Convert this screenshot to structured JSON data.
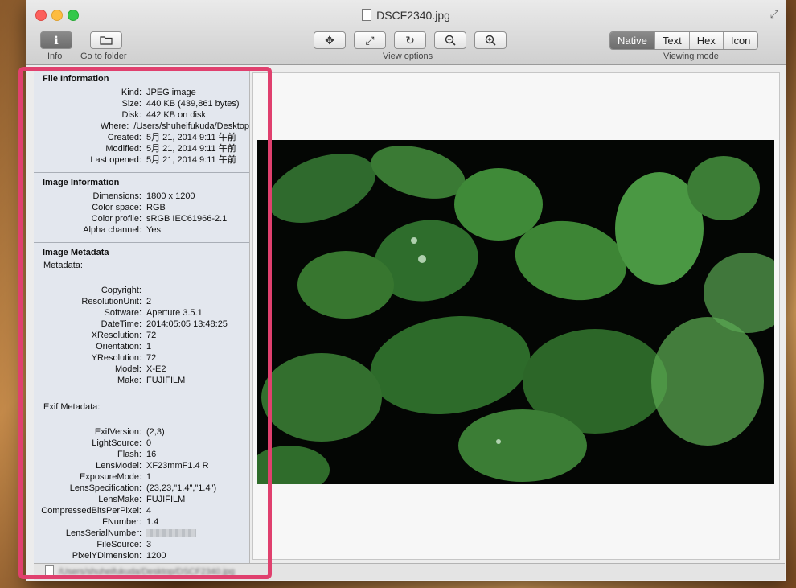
{
  "window": {
    "title": "DSCF2340.jpg"
  },
  "toolbar": {
    "info_label": "Info",
    "goto_folder_label": "Go to folder",
    "view_options_label": "View options",
    "viewing_mode_label": "Viewing mode",
    "modes": [
      "Native",
      "Text",
      "Hex",
      "Icon"
    ],
    "selected_mode": "Native"
  },
  "file_info": {
    "heading": "File Information",
    "rows": [
      {
        "k": "Kind:",
        "v": "JPEG image"
      },
      {
        "k": "Size:",
        "v": "440 KB (439,861 bytes)"
      },
      {
        "k": "Disk:",
        "v": "442 KB on disk"
      },
      {
        "k": "Where:",
        "v": "/Users/shuheifukuda/Desktop"
      },
      {
        "k": "Created:",
        "v": "5月 21, 2014 9:11 午前"
      },
      {
        "k": "Modified:",
        "v": "5月 21, 2014 9:11 午前"
      },
      {
        "k": "Last opened:",
        "v": "5月 21, 2014 9:11 午前"
      }
    ]
  },
  "image_info": {
    "heading": "Image Information",
    "rows": [
      {
        "k": "Dimensions:",
        "v": "1800 x 1200"
      },
      {
        "k": "Color space:",
        "v": "RGB"
      },
      {
        "k": "Color profile:",
        "v": "sRGB IEC61966-2.1"
      },
      {
        "k": "Alpha channel:",
        "v": "Yes"
      }
    ]
  },
  "metadata": {
    "heading": "Image Metadata",
    "sub_label": "Metadata:",
    "rows": [
      {
        "k": "Copyright:",
        "v": ""
      },
      {
        "k": "ResolutionUnit:",
        "v": "2"
      },
      {
        "k": "Software:",
        "v": "Aperture 3.5.1"
      },
      {
        "k": "DateTime:",
        "v": "2014:05:05 13:48:25"
      },
      {
        "k": "XResolution:",
        "v": "72"
      },
      {
        "k": "Orientation:",
        "v": "1"
      },
      {
        "k": "YResolution:",
        "v": "72"
      },
      {
        "k": "Model:",
        "v": "X-E2"
      },
      {
        "k": "Make:",
        "v": "FUJIFILM"
      }
    ],
    "exif_label": "Exif Metadata:",
    "exif_rows": [
      {
        "k": "ExifVersion:",
        "v": "(2,3)"
      },
      {
        "k": "LightSource:",
        "v": "0"
      },
      {
        "k": "Flash:",
        "v": "16"
      },
      {
        "k": "LensModel:",
        "v": "XF23mmF1.4 R"
      },
      {
        "k": "ExposureMode:",
        "v": "1"
      },
      {
        "k": "LensSpecification:",
        "v": "(23,23,\"1.4\",\"1.4\")"
      },
      {
        "k": "LensMake:",
        "v": "FUJIFILM"
      },
      {
        "k": "CompressedBitsPerPixel:",
        "v": "4"
      },
      {
        "k": "FNumber:",
        "v": "1.4"
      },
      {
        "k": "LensSerialNumber:",
        "v": ""
      },
      {
        "k": "FileSource:",
        "v": "3"
      },
      {
        "k": "PixelYDimension:",
        "v": "1200"
      }
    ]
  },
  "pathbar": {
    "text": "/Users/shuheifukuda/Desktop/DSCF2340.jpg"
  },
  "colors": {
    "highlight": "#e0406e",
    "active_segment": "#7a7a7a"
  }
}
